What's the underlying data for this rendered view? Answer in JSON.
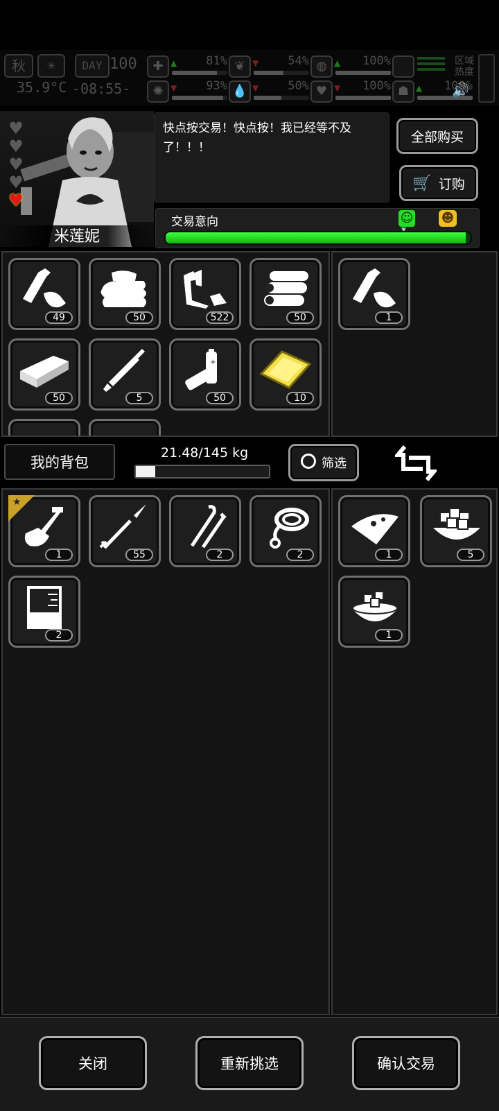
{
  "status": {
    "season": "秋",
    "day_label": "DAY",
    "day_number": "100",
    "temperature": "35.9°C",
    "time": "-08:55-",
    "region_heat_label": "区域\n热度",
    "indicators": [
      {
        "icon": "first-aid-icon",
        "arrow": "up",
        "value": "81%",
        "level": 0.81
      },
      {
        "icon": "stomach-icon",
        "arrow": "down",
        "value": "54%",
        "level": 0.54
      },
      {
        "icon": "stamina-icon",
        "arrow": "up",
        "value": "100%",
        "level": 1.0
      },
      {
        "icon": "brain-icon",
        "arrow": "down",
        "value": "93%",
        "level": 0.93
      },
      {
        "icon": "water-drop-icon",
        "arrow": "down",
        "value": "50%",
        "level": 0.5
      },
      {
        "icon": "heart-icon",
        "arrow": "down",
        "value": "100%",
        "level": 1.0
      },
      {
        "icon": "mood-icon",
        "arrow": "up",
        "value": "100%",
        "level": 1.0
      }
    ]
  },
  "trader": {
    "name": "米莲妮",
    "hearts_total": 5,
    "hearts_filled": 1,
    "dialog": "快点按交易！快点按！我已经等不及了！！！",
    "buy_all_label": "全部购买",
    "order_label": "订购",
    "intent_label": "交易意向",
    "intent_level": 0.985
  },
  "trader_inventory": [
    {
      "icon": "plastic-bottle-icon",
      "count": "49"
    },
    {
      "icon": "cloth-icon",
      "count": "50"
    },
    {
      "icon": "scrap-metal-icon",
      "count": "522"
    },
    {
      "icon": "logs-icon",
      "count": "50"
    },
    {
      "icon": "plank-icon",
      "count": "50"
    },
    {
      "icon": "syringe-icon",
      "count": "5"
    },
    {
      "icon": "battery-icon",
      "count": "50"
    },
    {
      "icon": "gold-plate-icon",
      "count": "10"
    }
  ],
  "trader_offer": [
    {
      "icon": "plastic-bottle-icon",
      "count": "1"
    }
  ],
  "bag": {
    "label": "我的背包",
    "weight": "21.48/145 kg",
    "weight_fraction": 0.148,
    "filter_label": "筛选"
  },
  "my_inventory": [
    {
      "icon": "shovel-icon",
      "count": "1",
      "starred": true
    },
    {
      "icon": "spear-icon",
      "count": "55"
    },
    {
      "icon": "lockpick-icon",
      "count": "2"
    },
    {
      "icon": "rope-icon",
      "count": "2"
    },
    {
      "icon": "beaker-icon",
      "count": "2"
    }
  ],
  "my_offer": [
    {
      "icon": "pizza-slice-icon",
      "count": "1"
    },
    {
      "icon": "tofu-bowl-icon",
      "count": "5"
    },
    {
      "icon": "food-bowl-icon",
      "count": "1"
    }
  ],
  "buttons": {
    "close": "关闭",
    "reselect": "重新挑选",
    "confirm": "确认交易"
  }
}
